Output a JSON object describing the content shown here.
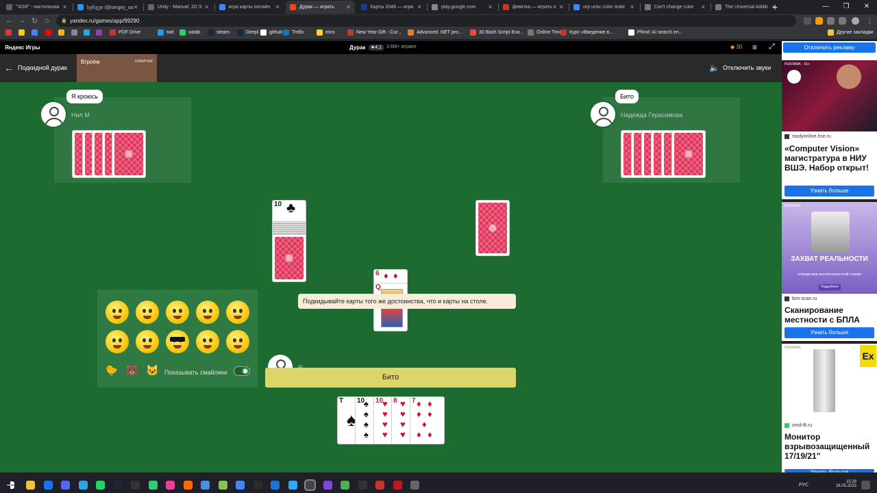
{
  "browser": {
    "tabs": [
      {
        "title": "\"ХОЙ\" - настольная",
        "color": "#5f6368"
      },
      {
        "title": "სერგეი (@sergey_sa",
        "color": "#1d9bf0"
      },
      {
        "title": "Unity - Manual: 2D S",
        "color": "#666"
      },
      {
        "title": "игра карты онлайн",
        "color": "#4285f4"
      },
      {
        "title": "Дурак — играть",
        "color": "#fc3f1d",
        "active": true
      },
      {
        "title": "Карты 2048 — игра",
        "color": "#1e3a8a"
      },
      {
        "title": "play.google.com",
        "color": "#888"
      },
      {
        "title": "Девятка — играть о",
        "color": "#c0392b"
      },
      {
        "title": "urp unlic color mate",
        "color": "#4285f4"
      },
      {
        "title": "Can't change color",
        "color": "#777"
      },
      {
        "title": "The Universal Additi",
        "color": "#777"
      }
    ],
    "new_tab": "+",
    "url": "yandex.ru/games/app/99290",
    "bookmarks": [
      {
        "label": "",
        "color": "#e03a3a"
      },
      {
        "label": "",
        "color": "#ffcc00"
      },
      {
        "label": "",
        "color": "#4285f4"
      },
      {
        "label": "",
        "color": "#ff0000"
      },
      {
        "label": "",
        "color": "#f4b400"
      },
      {
        "label": "",
        "color": "#888"
      },
      {
        "label": "",
        "color": "#2ca5e0"
      },
      {
        "label": "",
        "color": "#8e44ad"
      },
      {
        "label": "PDF Drive",
        "color": "#c0392b"
      },
      {
        "label": "twit",
        "color": "#1d9bf0"
      },
      {
        "label": "xatab",
        "color": "#2ecc71"
      },
      {
        "label": "steam",
        "color": "#1b2838"
      },
      {
        "label": "Deepl",
        "color": "#0f2b46"
      },
      {
        "label": "github",
        "color": "#fff"
      },
      {
        "label": "Trello",
        "color": "#0079bf"
      },
      {
        "label": "miro",
        "color": "#ffd02f"
      },
      {
        "label": "New Year Gift - Cur...",
        "color": "#c0392b"
      },
      {
        "label": "Advanced .NET pro...",
        "color": "#e67e22"
      },
      {
        "label": "30 Bash Script Exa...",
        "color": "#e74c3c"
      },
      {
        "label": "Online Timer",
        "color": "#777"
      },
      {
        "label": "Курс «Введение в...",
        "color": "#c0392b"
      },
      {
        "label": "Phind: AI search en...",
        "color": "#fff"
      }
    ],
    "other_bookmarks": "Другие закладки"
  },
  "yandex": {
    "logo": "Яндекс Игры",
    "game": "Дурак",
    "rating": "★4,1",
    "playing": "3,6М+ играют",
    "coins": "30"
  },
  "game_header": {
    "title": "Подкидной дурак",
    "mode": "Втроём",
    "level": "новичок",
    "sound": "Отключить звуки"
  },
  "players": {
    "left": {
      "name": "Нил М",
      "bubble": "Я кроюсь"
    },
    "right": {
      "name": "Надежда Герасимова",
      "bubble": "Бито"
    },
    "me": {
      "name": "R"
    }
  },
  "table_cards": {
    "deck_top": {
      "rank": "10",
      "suit": "♣"
    },
    "attack": {
      "rank": "6",
      "suit": "♦"
    },
    "defense": {
      "rank": "Q",
      "suit": "♦"
    }
  },
  "hand": [
    {
      "rank": "Т",
      "suit": "♠",
      "color": "black"
    },
    {
      "rank": "10",
      "suit": "♠",
      "color": "black"
    },
    {
      "rank": "10",
      "suit": "♥",
      "color": "red"
    },
    {
      "rank": "8",
      "suit": "♥",
      "color": "red"
    },
    {
      "rank": "7",
      "suit": "♦",
      "color": "red"
    }
  ],
  "hint": "Подкидывайте карты того же достоинства, что и карты на столе.",
  "action_button": "Бито",
  "emoji_panel": {
    "toggle_label": "Показывать смайлики",
    "toggle_on": true
  },
  "ads": {
    "disable_ads": "Отключить рекламу",
    "ad1": {
      "label": "РЕКЛАМА · 16+",
      "domain": "studyonline.hse.ru",
      "title": "«Computer Vision» магистратура в НИУ ВШЭ. Набор открыт!",
      "button": "Узнать больше"
    },
    "ad2": {
      "label": "РЕКЛАМА",
      "headline": "ЗАХВАТ РЕАЛЬНОСТИ",
      "sub": "посредством высокоскоростной съемки",
      "more": "Подробнее",
      "domain": "bim-scan.ru",
      "title": "Сканирование местности с БПЛА",
      "button": "Узнать больше"
    },
    "ad3": {
      "label": "РЕКЛАМА",
      "domain": "smd-tlt.ru",
      "title": "Монитор взрывозащищенный 17/19/21\"",
      "button": "Узнать больше"
    }
  },
  "taskbar": {
    "lang": "РУС",
    "time": "15:28",
    "date": "26.05.2023"
  }
}
